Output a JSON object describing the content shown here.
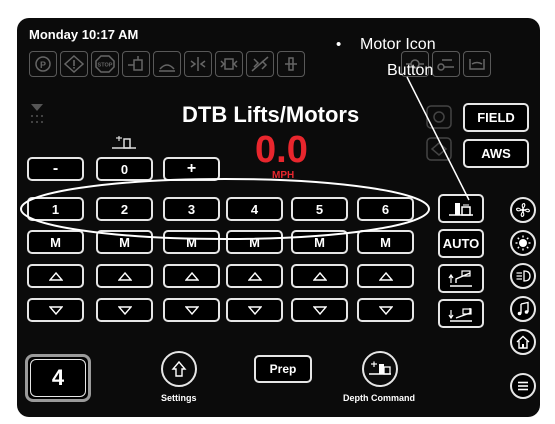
{
  "status_bar": {
    "datetime": "Monday 10:17 AM"
  },
  "annotation": {
    "bullet": "•",
    "line1": "Motor Icon",
    "line2": "Button"
  },
  "title": "DTB Lifts/Motors",
  "speed": {
    "value": "0.0",
    "unit": "MPH"
  },
  "right_buttons": {
    "field": "FIELD",
    "aws": "AWS",
    "auto": "AUTO"
  },
  "control_row": {
    "minus": "-",
    "value": "0",
    "plus": "+"
  },
  "section_buttons": [
    "1",
    "2",
    "3",
    "4",
    "5",
    "6"
  ],
  "manual_buttons": [
    "M",
    "M",
    "M",
    "M",
    "M",
    "M"
  ],
  "bottom": {
    "gear": "4",
    "settings": "Settings",
    "prep": "Prep",
    "depth": "Depth Command"
  },
  "colors": {
    "speed": "#e8262d",
    "background": "#0b0b0b",
    "accent_outline": "#ffffff"
  }
}
